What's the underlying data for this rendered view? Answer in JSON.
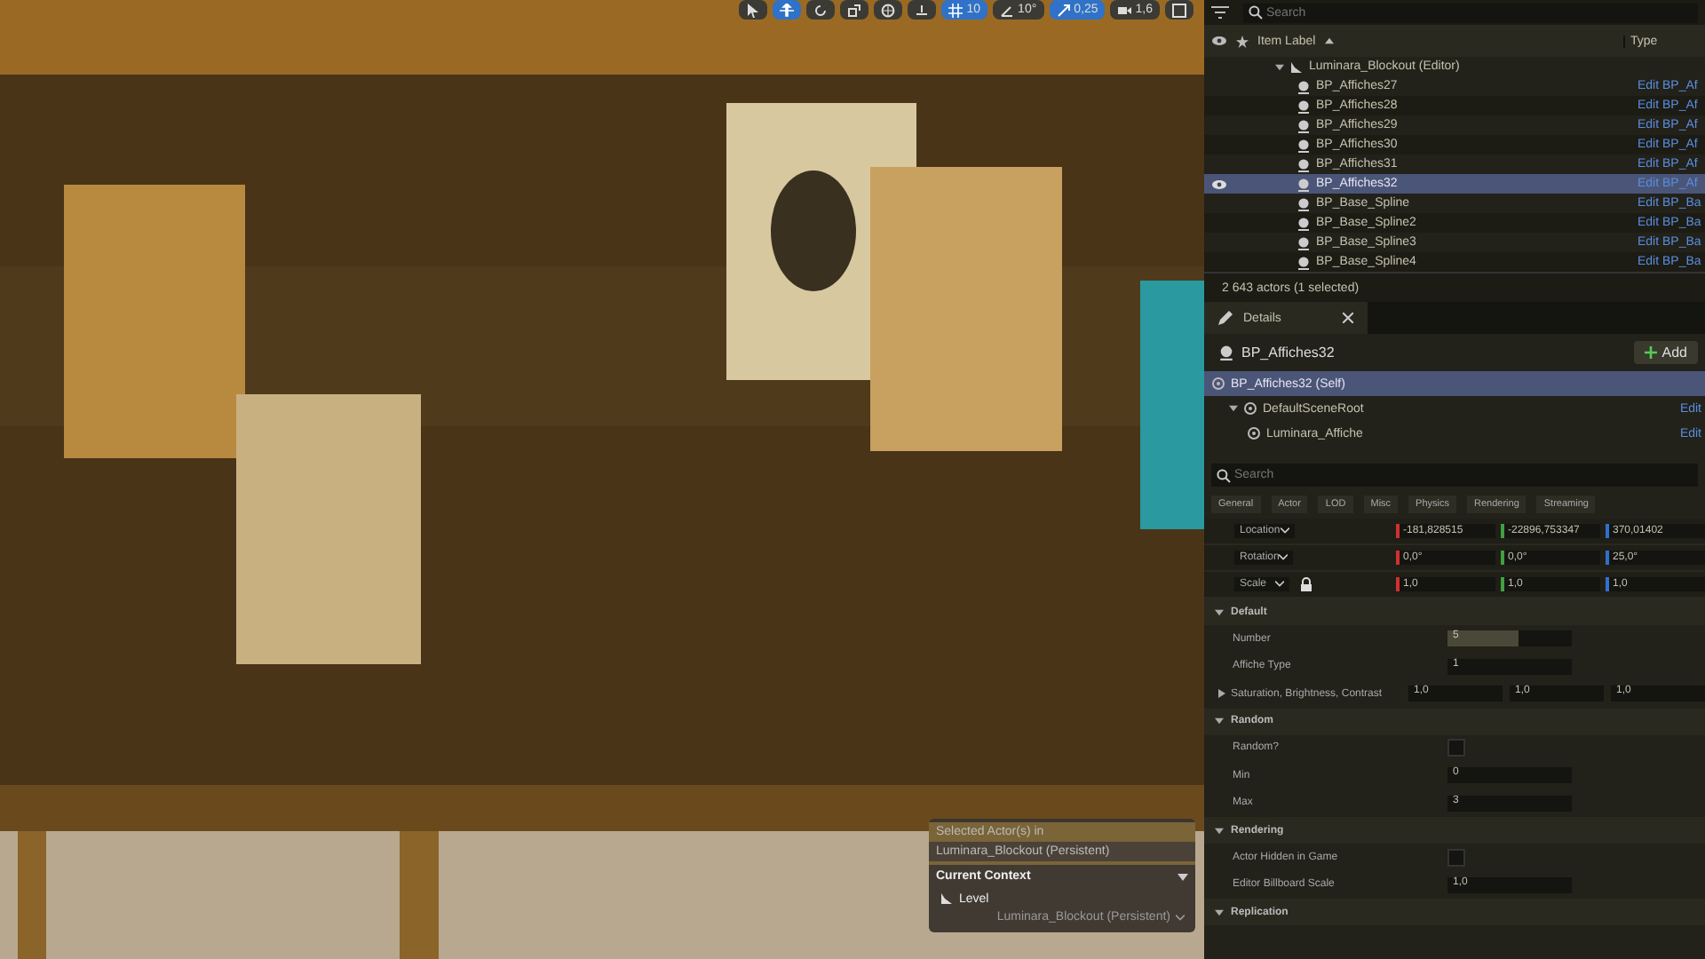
{
  "viewport": {
    "toolbar": [
      {
        "kind": "select",
        "selected": false
      },
      {
        "kind": "move",
        "selected": true
      },
      {
        "kind": "rotate",
        "selected": false
      },
      {
        "kind": "scale",
        "selected": false
      },
      {
        "kind": "world",
        "selected": false
      },
      {
        "kind": "surface",
        "selected": false
      },
      {
        "kind": "grid",
        "selected": true,
        "value": "10"
      },
      {
        "kind": "angle",
        "selected": false,
        "value": "10°"
      },
      {
        "kind": "scalesnap",
        "selected": true,
        "value": "0,25"
      },
      {
        "kind": "camera",
        "selected": false,
        "value": "1,6"
      },
      {
        "kind": "layout",
        "selected": false
      }
    ],
    "context_popup": {
      "title_lines": [
        "Selected Actor(s) in",
        "Luminara_Blockout (Persistent)"
      ],
      "section": "Current Context",
      "level_label": "Level",
      "level_value": "Luminara_Blockout (Persistent)"
    }
  },
  "outliner": {
    "search": {
      "placeholder": "Search"
    },
    "columns": [
      "Item Label",
      "Type"
    ],
    "root": {
      "label": "Luminara_Blockout (Editor)",
      "expanded": true,
      "children": [
        {
          "label": "BP_Affiches27",
          "type": "Edit BP_Af",
          "selected": false
        },
        {
          "label": "BP_Affiches28",
          "type": "Edit BP_Af",
          "selected": false
        },
        {
          "label": "BP_Affiches29",
          "type": "Edit BP_Af",
          "selected": false
        },
        {
          "label": "BP_Affiches30",
          "type": "Edit BP_Af",
          "selected": false
        },
        {
          "label": "BP_Affiches31",
          "type": "Edit BP_Af",
          "selected": false
        },
        {
          "label": "BP_Affiches32",
          "type": "Edit BP_Af",
          "selected": true
        },
        {
          "label": "BP_Base_Spline",
          "type": "Edit BP_Ba",
          "selected": false
        },
        {
          "label": "BP_Base_Spline2",
          "type": "Edit BP_Ba",
          "selected": false
        },
        {
          "label": "BP_Base_Spline3",
          "type": "Edit BP_Ba",
          "selected": false
        },
        {
          "label": "BP_Base_Spline4",
          "type": "Edit BP_Ba",
          "selected": false
        }
      ]
    },
    "status": "2 643 actors (1 selected)"
  },
  "details": {
    "tab": "Details",
    "actor": "BP_Affiches32",
    "add_button": "Add",
    "components": [
      {
        "label": "BP_Affiches32 (Self)",
        "selected": true,
        "children": [
          {
            "label": "DefaultSceneRoot",
            "action": "Edit",
            "selected": false,
            "expanded": true,
            "children": [
              {
                "label": "Luminara_Affiche",
                "action": "Edit",
                "selected": false
              }
            ]
          }
        ]
      }
    ],
    "search": {
      "placeholder": "Search"
    },
    "filters": [
      "General",
      "Actor",
      "LOD",
      "Misc",
      "Physics",
      "Rendering",
      "Streaming"
    ],
    "transform": [
      {
        "label": "Location",
        "locked": false,
        "values": [
          "-181,828515",
          "-22896,753347",
          "370,01402"
        ]
      },
      {
        "label": "Rotation",
        "locked": false,
        "values": [
          "0,0°",
          "0,0°",
          "25,0°"
        ]
      },
      {
        "label": "Scale",
        "locked": true,
        "values": [
          "1,0",
          "1,0",
          "1,0"
        ]
      }
    ],
    "sections": [
      {
        "title": "Default",
        "rows": [
          {
            "kind": "slider",
            "label": "Number",
            "value": "5",
            "level": 0.57
          },
          {
            "kind": "number",
            "label": "Affiche Type",
            "value": "1"
          },
          {
            "kind": "vector",
            "label": "Saturation, Brightness, Contrast",
            "values": [
              "1,0",
              "1,0",
              "1,0"
            ]
          }
        ]
      },
      {
        "title": "Random",
        "rows": [
          {
            "kind": "checkbox",
            "label": "Random?",
            "checked": false
          },
          {
            "kind": "number",
            "label": "Min",
            "value": "0"
          },
          {
            "kind": "number",
            "label": "Max",
            "value": "3"
          }
        ]
      },
      {
        "title": "Rendering",
        "rows": [
          {
            "kind": "checkbox",
            "label": "Actor Hidden in Game",
            "checked": false
          },
          {
            "kind": "number",
            "label": "Editor Billboard Scale",
            "value": "1,0"
          }
        ]
      },
      {
        "title": "Replication"
      }
    ]
  }
}
